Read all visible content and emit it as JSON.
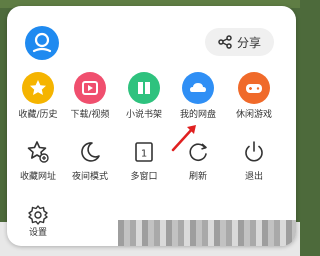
{
  "share": {
    "label": "分享",
    "icon": "share-icon"
  },
  "avatar": {
    "icon": "user-icon",
    "color": "#1f8af0"
  },
  "row1": [
    {
      "label": "收藏/历史",
      "icon": "star-icon",
      "color": "#f5b400"
    },
    {
      "label": "下载/视频",
      "icon": "download-video-icon",
      "color": "#f04f6e"
    },
    {
      "label": "小说书架",
      "icon": "book-icon",
      "color": "#2ec27e"
    },
    {
      "label": "我的网盘",
      "icon": "cloud-icon",
      "color": "#2f8ff5"
    },
    {
      "label": "休闲游戏",
      "icon": "gamepad-icon",
      "color": "#f06a2a"
    }
  ],
  "row2": [
    {
      "label": "收藏网址",
      "icon": "star-add-icon"
    },
    {
      "label": "夜间模式",
      "icon": "moon-icon"
    },
    {
      "label": "多窗口",
      "icon": "window-icon",
      "badge": "1"
    },
    {
      "label": "刷新",
      "icon": "refresh-icon"
    },
    {
      "label": "退出",
      "icon": "power-icon"
    }
  ],
  "row3": [
    {
      "label": "设置",
      "icon": "gear-icon"
    }
  ]
}
